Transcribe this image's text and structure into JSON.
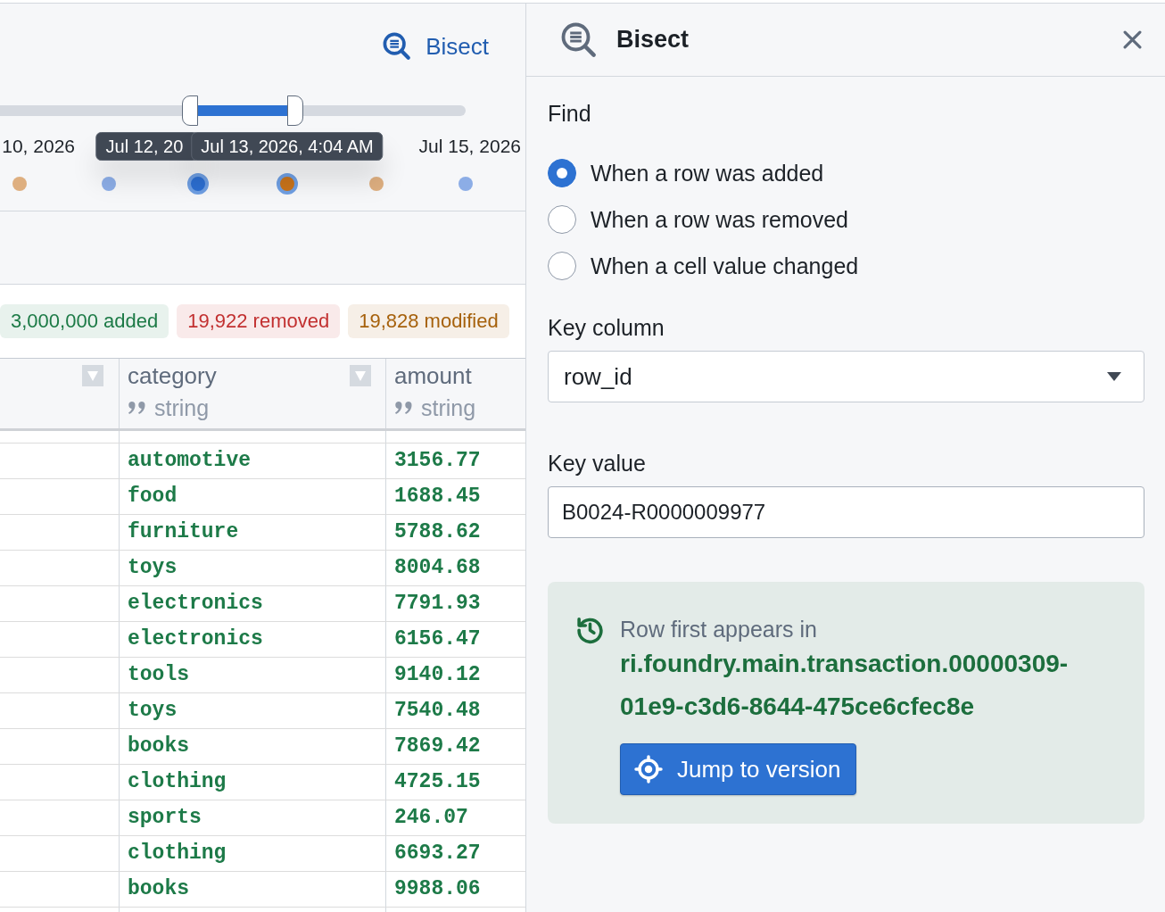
{
  "timeline": {
    "bisect_link": "Bisect",
    "points": [
      {
        "color": "#deaf80",
        "selected": false,
        "label": "10, 2026"
      },
      {
        "color": "#8cade6",
        "selected": false
      },
      {
        "color": "#2d6fd2",
        "selected": true,
        "tooltip": "Jul 12, 20"
      },
      {
        "color": "#c8731b",
        "selected": true,
        "tooltip": "Jul 13, 2026, 4:04 AM"
      },
      {
        "color": "#deaf80",
        "selected": false
      },
      {
        "color": "#8cade6",
        "selected": false,
        "label": "Jul 15, 2026"
      }
    ]
  },
  "change_summary": [
    {
      "label": "3,000,000 added",
      "color": "#1c7a46"
    },
    {
      "label": "19,922 removed",
      "color": "#c23030"
    },
    {
      "label": "19,828 modified",
      "color": "#a6610c"
    }
  ],
  "table": {
    "column_1": {
      "filter_button": true
    },
    "columns": [
      {
        "name": "category",
        "type": "string",
        "filter_button": true
      },
      {
        "name": "amount",
        "type": "string",
        "filter_button": false
      }
    ],
    "rows": [
      [
        "automotive",
        "3156.77"
      ],
      [
        "food",
        "1688.45"
      ],
      [
        "furniture",
        "5788.62"
      ],
      [
        "toys",
        "8004.68"
      ],
      [
        "electronics",
        "7791.93"
      ],
      [
        "electronics",
        "6156.47"
      ],
      [
        "tools",
        "9140.12"
      ],
      [
        "toys",
        "7540.48"
      ],
      [
        "books",
        "7869.42"
      ],
      [
        "clothing",
        "4725.15"
      ],
      [
        "sports",
        "246.07"
      ],
      [
        "clothing",
        "6693.27"
      ],
      [
        "books",
        "9988.06"
      ]
    ]
  },
  "bisect_panel": {
    "title": "Bisect",
    "find_label": "Find",
    "options": [
      {
        "label": "When a row was added",
        "selected": true
      },
      {
        "label": "When a row was removed",
        "selected": false
      },
      {
        "label": "When a cell value changed",
        "selected": false
      }
    ],
    "key_column": {
      "label": "Key column",
      "value": "row_id"
    },
    "key_value": {
      "label": "Key value",
      "value": "B0024-R0000009977"
    },
    "result": {
      "caption": "Row first appears in",
      "transaction": "ri.foundry.main.transaction.00000309-01e9-c3d6-8644-475ce6cfec8e",
      "button": "Jump to version"
    }
  }
}
